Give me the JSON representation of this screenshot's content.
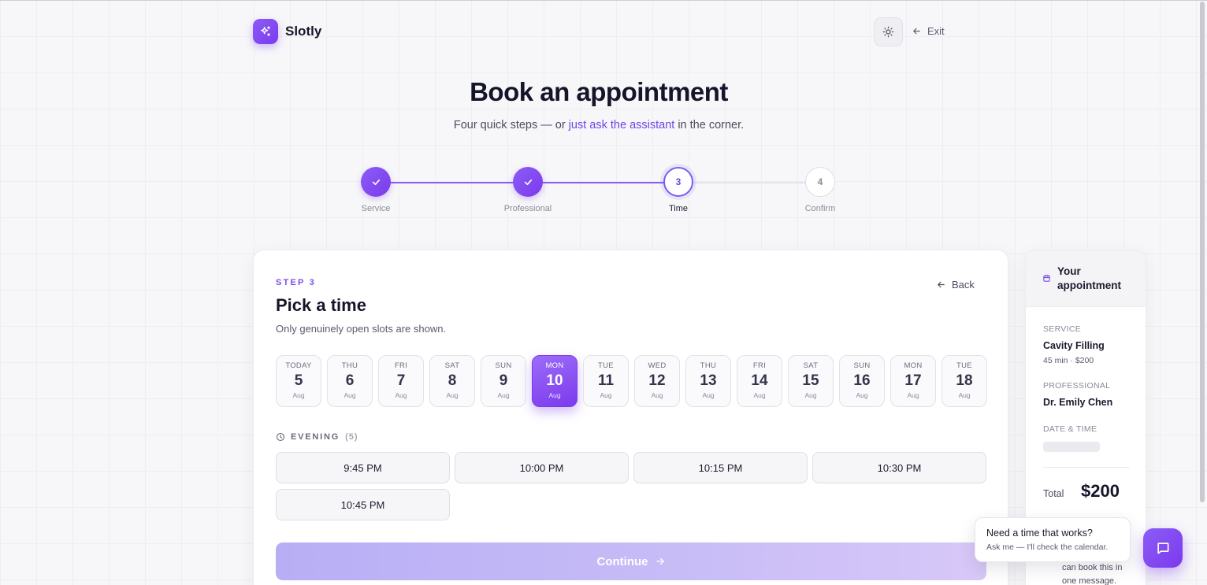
{
  "brand": {
    "name": "Slotly",
    "logo_icon": "sparkles-icon",
    "accent": "#7c3aed"
  },
  "header": {
    "exit_label": "Exit",
    "theme_icon": "sun-icon"
  },
  "hero": {
    "title": "Book an appointment",
    "subtitle_before": "Four quick steps — or ",
    "subtitle_link": "just ask the assistant",
    "subtitle_after": " in the corner."
  },
  "stepper": [
    {
      "label": "Service",
      "state": "done",
      "mark": ""
    },
    {
      "label": "Professional",
      "state": "done",
      "mark": ""
    },
    {
      "label": "Time",
      "state": "active",
      "mark": "3"
    },
    {
      "label": "Confirm",
      "state": "todo",
      "mark": "4"
    }
  ],
  "step": {
    "tag": "STEP 3",
    "title": "Pick a time",
    "subtitle": "Only genuinely open slots are shown.",
    "back_label": "Back"
  },
  "dates": [
    {
      "dow": "TODAY",
      "day": "5",
      "mon": "Aug"
    },
    {
      "dow": "THU",
      "day": "6",
      "mon": "Aug"
    },
    {
      "dow": "FRI",
      "day": "7",
      "mon": "Aug"
    },
    {
      "dow": "SAT",
      "day": "8",
      "mon": "Aug"
    },
    {
      "dow": "SUN",
      "day": "9",
      "mon": "Aug"
    },
    {
      "dow": "MON",
      "day": "10",
      "mon": "Aug",
      "selected": true
    },
    {
      "dow": "TUE",
      "day": "11",
      "mon": "Aug"
    },
    {
      "dow": "WED",
      "day": "12",
      "mon": "Aug"
    },
    {
      "dow": "THU",
      "day": "13",
      "mon": "Aug"
    },
    {
      "dow": "FRI",
      "day": "14",
      "mon": "Aug"
    },
    {
      "dow": "SAT",
      "day": "15",
      "mon": "Aug"
    },
    {
      "dow": "SUN",
      "day": "16",
      "mon": "Aug"
    },
    {
      "dow": "MON",
      "day": "17",
      "mon": "Aug"
    },
    {
      "dow": "TUE",
      "day": "18",
      "mon": "Aug"
    }
  ],
  "evening": {
    "label": "EVENING",
    "count": "(5)",
    "slots": [
      "9:45 PM",
      "10:00 PM",
      "10:15 PM",
      "10:30 PM",
      "10:45 PM"
    ]
  },
  "continue_label": "Continue",
  "summary": {
    "title_line1": "Your",
    "title_line2": "appointment",
    "service_label": "SERVICE",
    "service_value": "Cavity Filling",
    "service_meta": "45 min · $200",
    "professional_label": "PROFESSIONAL",
    "professional_value": "Dr. Emily Chen",
    "datetime_label": "DATE & TIME",
    "total_label": "Total",
    "total_value": "$200",
    "foot_line1": "can book this in",
    "foot_line2": "one message."
  },
  "assistant": {
    "bubble_title": "Need a time that works?",
    "bubble_sub": "Ask me — I'll check the calendar."
  }
}
